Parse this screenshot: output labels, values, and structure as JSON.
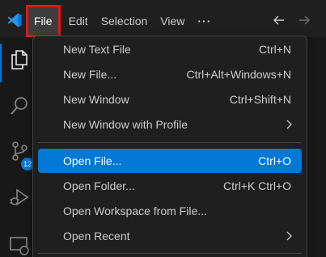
{
  "menubar": {
    "items": [
      "File",
      "Edit",
      "Selection",
      "View",
      "···"
    ]
  },
  "file_menu": {
    "groups": [
      [
        {
          "label": "New Text File",
          "shortcut": "Ctrl+N"
        },
        {
          "label": "New File...",
          "shortcut": "Ctrl+Alt+Windows+N"
        },
        {
          "label": "New Window",
          "shortcut": "Ctrl+Shift+N"
        },
        {
          "label": "New Window with Profile",
          "submenu": true
        }
      ],
      [
        {
          "label": "Open File...",
          "shortcut": "Ctrl+O",
          "highlighted": true
        },
        {
          "label": "Open Folder...",
          "shortcut": "Ctrl+K Ctrl+O"
        },
        {
          "label": "Open Workspace from File..."
        },
        {
          "label": "Open Recent",
          "submenu": true
        }
      ]
    ]
  },
  "activity_bar": {
    "icons": [
      "explorer-icon",
      "search-icon",
      "source-control-icon",
      "run-debug-icon",
      "remote-explorer-icon"
    ],
    "source_control_badge": "12"
  },
  "colors": {
    "accent": "#0078d4",
    "highlight_box": "#e01818",
    "menu_bg": "#1f1f1f"
  }
}
